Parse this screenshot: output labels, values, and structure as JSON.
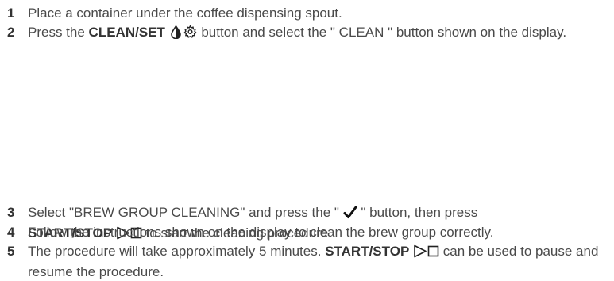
{
  "steps": [
    {
      "number": "1",
      "text": "Place a container under the coffee dispensing spout."
    },
    {
      "number": "2",
      "pre": "Press the ",
      "bold": "CLEAN/SET",
      "post": " button and select the \" CLEAN \" button shown on the display.",
      "icons": [
        "water-drop-icon",
        "gear-icon"
      ]
    },
    {
      "number": "3",
      "pre": "Select \"BREW GROUP CLEANING\" and press the \" ",
      "mid": " \" button, then press",
      "bold": "START/STOP",
      "post": " to start the cleaning procedure.",
      "icons": [
        "checkmark-icon",
        "play-icon",
        "stop-icon"
      ]
    },
    {
      "number": "4",
      "text": "Follow the instructions shown on the display to clean the brew group correctly."
    },
    {
      "number": "5",
      "pre": "The procedure will take approximately 5 minutes. ",
      "bold": "START/STOP",
      "post": " can be used to pause and resume the procedure.",
      "icons": [
        "play-icon",
        "stop-icon"
      ]
    }
  ],
  "colors": {
    "text": "#4a4a4a",
    "bold_text": "#333333",
    "icon": "#222222"
  }
}
